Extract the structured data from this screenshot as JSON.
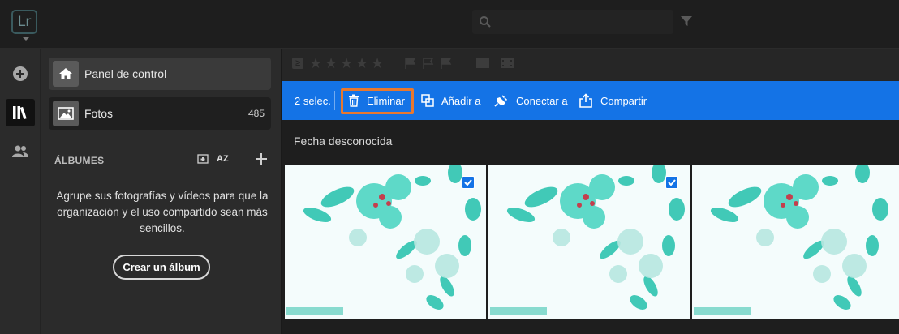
{
  "app": {
    "logo_text": "Lr"
  },
  "search": {
    "placeholder": "",
    "value": ""
  },
  "sidebar": {
    "items": [
      {
        "label": "Panel de control",
        "icon": "home-icon"
      },
      {
        "label": "Fotos",
        "icon": "photo-icon",
        "count": "485"
      }
    ],
    "albums_title": "ÁLBUMES",
    "albums_sort_label": "AZ",
    "albums_empty_text": "Agrupe sus fotografías y vídeos para que la organización y el uso compartido sean más sencillos.",
    "create_album_label": "Crear un álbum"
  },
  "filter": {
    "rating_operator": "≥",
    "stars": 5
  },
  "actionbar": {
    "selection": "2 selec.",
    "delete_label": "Eliminar",
    "add_to_label": "Añadir a",
    "connect_label": "Conectar a",
    "share_label": "Compartir",
    "highlight_color": "#e8782f",
    "bar_color": "#1473e6"
  },
  "grid": {
    "date_header": "Fecha desconocida",
    "photos": [
      {
        "selected": true
      },
      {
        "selected": true
      },
      {
        "selected": false
      }
    ]
  }
}
